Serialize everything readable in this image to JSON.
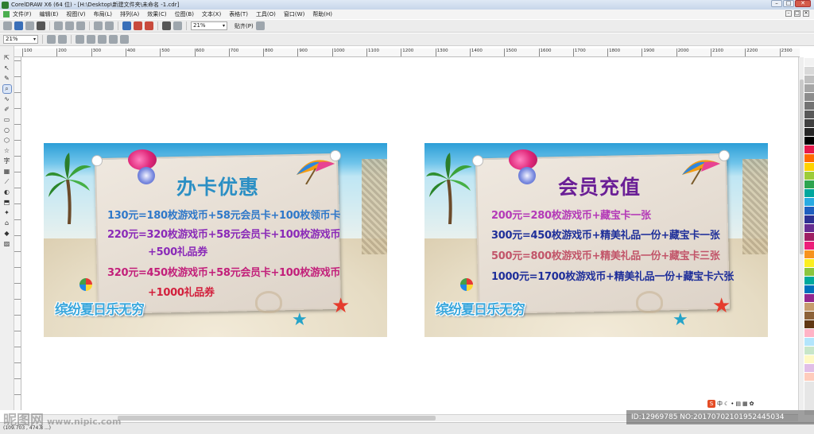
{
  "window": {
    "title": "CorelDRAW X6 (64 位) - [H:\\Desktop\\新建文件夹\\未命名 -1.cdr]",
    "controls": [
      "–",
      "□",
      "✕"
    ]
  },
  "menu": {
    "items": [
      "文件(F)",
      "编辑(E)",
      "视图(V)",
      "布局(L)",
      "排列(A)",
      "效果(C)",
      "位图(B)",
      "文本(X)",
      "表格(T)",
      "工具(O)",
      "窗口(W)",
      "帮助(H)"
    ],
    "mdi_controls": [
      "–",
      "□",
      "✕"
    ]
  },
  "toolbar": {
    "zoom": "21%",
    "snap_label": "贴齐(P)"
  },
  "propbar": {
    "zoom": "21%"
  },
  "ruler": {
    "h_ticks": [
      "100",
      "200",
      "300",
      "400",
      "500",
      "600",
      "700",
      "800",
      "900",
      "1000",
      "1100",
      "1200",
      "1300",
      "1400",
      "1500",
      "1600",
      "1700",
      "1800",
      "1900",
      "2000",
      "2100",
      "2200",
      "2300"
    ]
  },
  "tools": [
    "⇱",
    "↖",
    "✎",
    "⌕",
    "∿",
    "✐",
    "▭",
    "○",
    "⬡",
    "☆",
    "字",
    "▦",
    "⟋",
    "◐",
    "⬒",
    "✦",
    "⌂",
    "◆",
    "▨"
  ],
  "banners": [
    {
      "title": "办卡优惠",
      "title_color": "#2b8fc4",
      "lines": [
        {
          "text": "130元=180枚游戏币+58元会员卡+100枚领币卡",
          "color": "#2f78c9"
        },
        {
          "text": "220元=320枚游戏币+58元会员卡+100枚游戏币",
          "color": "#8a2ab8"
        },
        {
          "text": "+500礼品券",
          "color": "#8a2ab8"
        },
        {
          "text": "320元=450枚游戏币+58元会员卡+100枚游戏币",
          "color": "#c21f7a"
        },
        {
          "text": "+1000礼品券",
          "color": "#d21f3c"
        }
      ],
      "logo": "缤纷夏日乐无穷"
    },
    {
      "title": "会员充值",
      "title_color": "#6a1f96",
      "lines": [
        {
          "text": "200元=280枚游戏币+藏宝卡一张",
          "color": "#b43ab8"
        },
        {
          "text": "300元=450枚游戏币+精美礼品一份+藏宝卡一张",
          "color": "#1f2f9a"
        },
        {
          "text": "500元=800枚游戏币+精美礼品一份+藏宝卡三张",
          "color": "#c2556a"
        },
        {
          "text": "1000元=1700枚游戏币+精美礼品一份+藏宝卡六张",
          "color": "#1f2f9a"
        }
      ],
      "logo": "缤纷夏日乐无穷"
    }
  ],
  "palette": [
    "#ffffff",
    "#f2f2f2",
    "#d9d9d9",
    "#bfbfbf",
    "#a6a6a6",
    "#8c8c8c",
    "#737373",
    "#595959",
    "#404040",
    "#262626",
    "#000000",
    "#e6194b",
    "#ff6a00",
    "#ffd200",
    "#9ccc3a",
    "#2ea44f",
    "#00a79d",
    "#29abe2",
    "#1f5fbf",
    "#2e3192",
    "#662d91",
    "#9e1f63",
    "#ed1e79",
    "#f7931e",
    "#fcee21",
    "#8cc63f",
    "#00a99d",
    "#0071bc",
    "#93278f",
    "#c69c6d",
    "#8c6239",
    "#603813",
    "#ffb3c6",
    "#b3e5fc",
    "#c8e6c9",
    "#fff9c4",
    "#e1bee7",
    "#ffccbc"
  ],
  "status": {
    "coords": "(109.703 , 474.8 ...)"
  },
  "watermark": {
    "brand": "昵图网",
    "url": "www.nipic.com",
    "id": "ID:12969785 NO:20170702101952445034"
  },
  "ime": {
    "lang": "中",
    "logo": "S"
  }
}
